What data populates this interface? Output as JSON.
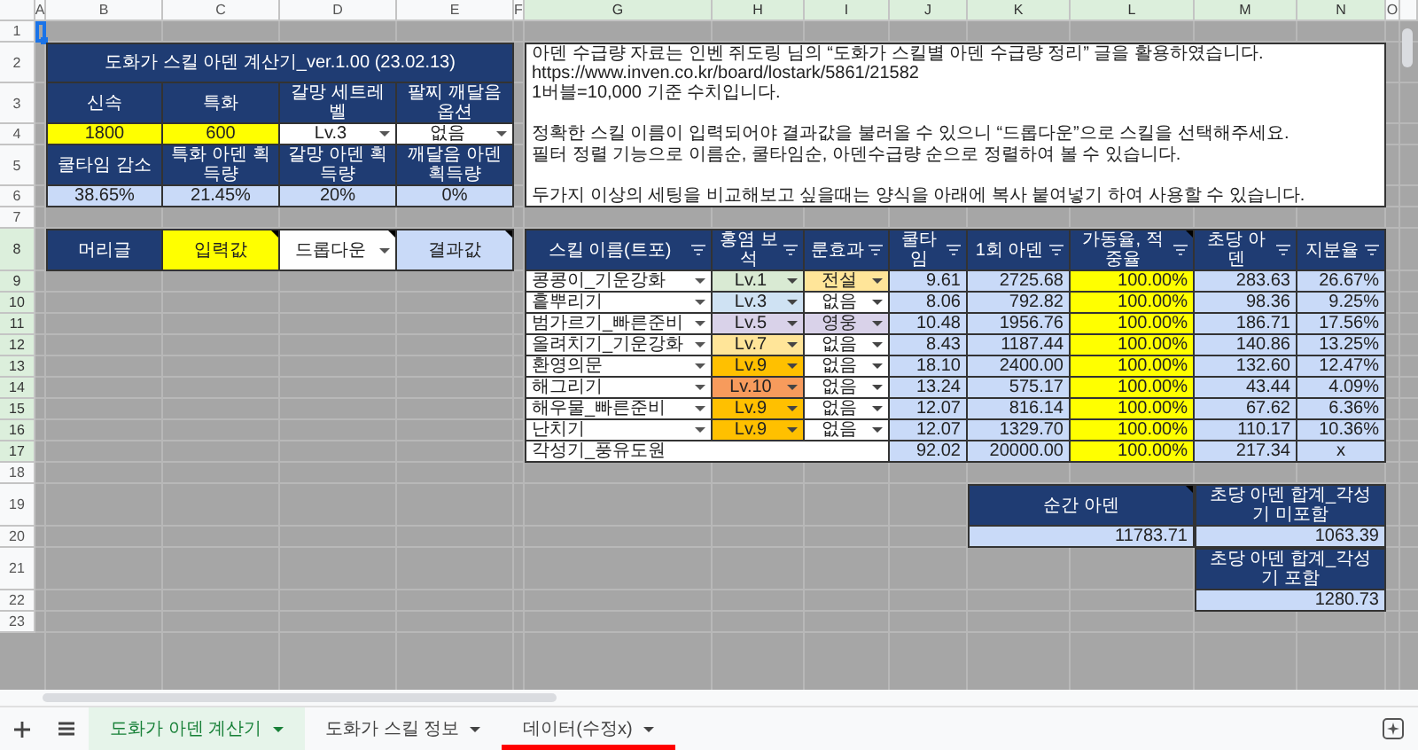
{
  "column_headers": [
    {
      "label": "A",
      "highlighted": false
    },
    {
      "label": "B",
      "highlighted": false
    },
    {
      "label": "C",
      "highlighted": false
    },
    {
      "label": "D",
      "highlighted": false
    },
    {
      "label": "E",
      "highlighted": false
    },
    {
      "label": "F",
      "highlighted": false
    },
    {
      "label": "G",
      "highlighted": true
    },
    {
      "label": "H",
      "highlighted": true
    },
    {
      "label": "I",
      "highlighted": true
    },
    {
      "label": "J",
      "highlighted": true
    },
    {
      "label": "K",
      "highlighted": true
    },
    {
      "label": "L",
      "highlighted": true
    },
    {
      "label": "M",
      "highlighted": true
    },
    {
      "label": "N",
      "highlighted": true
    },
    {
      "label": "O",
      "highlighted": false
    }
  ],
  "row_numbers": [
    {
      "label": "1",
      "highlighted": false
    },
    {
      "label": "2",
      "highlighted": false
    },
    {
      "label": "3",
      "highlighted": false
    },
    {
      "label": "4",
      "highlighted": false
    },
    {
      "label": "5",
      "highlighted": false
    },
    {
      "label": "6",
      "highlighted": false
    },
    {
      "label": "7",
      "highlighted": false
    },
    {
      "label": "8",
      "highlighted": true
    },
    {
      "label": "9",
      "highlighted": true
    },
    {
      "label": "10",
      "highlighted": true
    },
    {
      "label": "11",
      "highlighted": true
    },
    {
      "label": "12",
      "highlighted": true
    },
    {
      "label": "13",
      "highlighted": true
    },
    {
      "label": "14",
      "highlighted": true
    },
    {
      "label": "15",
      "highlighted": true
    },
    {
      "label": "16",
      "highlighted": true
    },
    {
      "label": "17",
      "highlighted": true
    },
    {
      "label": "18",
      "highlighted": false
    },
    {
      "label": "19",
      "highlighted": false
    },
    {
      "label": "20",
      "highlighted": false
    },
    {
      "label": "21",
      "highlighted": false
    },
    {
      "label": "22",
      "highlighted": false
    },
    {
      "label": "23",
      "highlighted": false
    }
  ],
  "calculator": {
    "title": "도화가 스킬 아덴 계산기_ver.1.00 (23.02.13)",
    "stat_headers": [
      "신속",
      "특화",
      "갈망 세트레벨",
      "팔찌 깨달음 옵션"
    ],
    "stat_values": [
      {
        "text": "1800",
        "kind": "input"
      },
      {
        "text": "600",
        "kind": "input"
      },
      {
        "text": "Lv.3",
        "kind": "dropdown"
      },
      {
        "text": "없음",
        "kind": "dropdown"
      }
    ],
    "result_headers": [
      "쿨타임 감소",
      "특화 아덴 획득량",
      "갈망 아덴 획득량",
      "깨달음 아덴 획득량"
    ],
    "result_values": [
      "38.65%",
      "21.45%",
      "20%",
      "0%"
    ]
  },
  "legend": [
    {
      "text": "머리글",
      "kind": "header",
      "note": false
    },
    {
      "text": "입력값",
      "kind": "input",
      "note": true
    },
    {
      "text": "드롭다운",
      "kind": "dropdown",
      "note": true
    },
    {
      "text": "결과값",
      "kind": "result",
      "note": true
    }
  ],
  "notes": [
    {
      "text": "아덴 수급량 자료는 인벤 쥐도링 님의 “도화가 스킬별 아덴 수급량 정리” 글을 활용하였습니다.",
      "link": "https://www.inven.co.kr/board/lostark/5861/21582"
    },
    {
      "text": "1버블=10,000 기준 수치입니다."
    },
    {
      "text": "정확한 스킬 이름이 입력되어야 결과값을 불러올 수 있으니 “드롭다운”으로 스킬을 선택해주세요."
    },
    {
      "text": "필터 정렬 기능으로 이름순, 쿨타임순, 아덴수급량 순으로 정렬하여 볼 수 있습니다."
    },
    {
      "text": "두가지 이상의 세팅을 비교해보고 싶을때는 양식을 아래에 복사 붙여넣기 하여 사용할 수 있습니다."
    }
  ],
  "skill_table": {
    "columns": [
      {
        "label": "스킬 이름(트포)",
        "note": false
      },
      {
        "label": "홍염 보석",
        "note": false
      },
      {
        "label": "룬효과",
        "note": false
      },
      {
        "label": "쿨타임",
        "note": false
      },
      {
        "label": "1회 아덴",
        "note": false
      },
      {
        "label": "가동율, 적중율",
        "note": true
      },
      {
        "label": "초당 아덴",
        "note": false
      },
      {
        "label": "지분율",
        "note": false
      }
    ],
    "rows": [
      {
        "skill": "콩콩이_기운강화",
        "gem": {
          "text": "Lv.1",
          "color": "#d9ead3"
        },
        "rune": {
          "text": "전설",
          "color": "#ffe599"
        },
        "cooldown": "9.61",
        "damage": "2725.68",
        "uptime": "100.00%",
        "per_second": "283.63",
        "share": "26.67%"
      },
      {
        "skill": "흩뿌리기",
        "gem": {
          "text": "Lv.3",
          "color": "#cfe2f3"
        },
        "rune": {
          "text": "없음",
          "color": "#ffffff"
        },
        "cooldown": "8.06",
        "damage": "792.82",
        "uptime": "100.00%",
        "per_second": "98.36",
        "share": "9.25%"
      },
      {
        "skill": "범가르기_빠른준비",
        "gem": {
          "text": "Lv.5",
          "color": "#d9d2e9"
        },
        "rune": {
          "text": "영웅",
          "color": "#d9d2e9"
        },
        "cooldown": "10.48",
        "damage": "1956.76",
        "uptime": "100.00%",
        "per_second": "186.71",
        "share": "17.56%"
      },
      {
        "skill": "올려치기_기운강화",
        "gem": {
          "text": "Lv.7",
          "color": "#ffe599"
        },
        "rune": {
          "text": "없음",
          "color": "#ffffff"
        },
        "cooldown": "8.43",
        "damage": "1187.44",
        "uptime": "100.00%",
        "per_second": "140.86",
        "share": "13.25%"
      },
      {
        "skill": "환영의문",
        "gem": {
          "text": "Lv.9",
          "color": "#ffc000"
        },
        "rune": {
          "text": "없음",
          "color": "#ffffff"
        },
        "cooldown": "18.10",
        "damage": "2400.00",
        "uptime": "100.00%",
        "per_second": "132.60",
        "share": "12.47%"
      },
      {
        "skill": "해그리기",
        "gem": {
          "text": "Lv.10",
          "color": "#f79b5c"
        },
        "rune": {
          "text": "없음",
          "color": "#ffffff"
        },
        "cooldown": "13.24",
        "damage": "575.17",
        "uptime": "100.00%",
        "per_second": "43.44",
        "share": "4.09%"
      },
      {
        "skill": "해우물_빠른준비",
        "gem": {
          "text": "Lv.9",
          "color": "#ffc000"
        },
        "rune": {
          "text": "없음",
          "color": "#ffffff"
        },
        "cooldown": "12.07",
        "damage": "816.14",
        "uptime": "100.00%",
        "per_second": "67.62",
        "share": "6.36%"
      },
      {
        "skill": "난치기",
        "gem": {
          "text": "Lv.9",
          "color": "#ffc000"
        },
        "rune": {
          "text": "없음",
          "color": "#ffffff"
        },
        "cooldown": "12.07",
        "damage": "1329.70",
        "uptime": "100.00%",
        "per_second": "110.17",
        "share": "10.36%"
      }
    ],
    "total": {
      "skill": "각성기_풍유도원",
      "cooldown": "92.02",
      "damage": "20000.00",
      "uptime": "100.00%",
      "per_second": "217.34",
      "share": "x"
    }
  },
  "summary": [
    {
      "label": "순간 아덴",
      "value": "11783.71",
      "note": true
    },
    {
      "label": "초당 아덴 합계_각성기 미포함",
      "value": "1063.39",
      "note": false
    },
    {
      "label": "초당 아덴 합계_각성기 포함",
      "value": "1280.73",
      "note": false
    }
  ],
  "sheet_tabs": [
    {
      "label": "도화가 아덴 계산기",
      "selected": true
    },
    {
      "label": "도화가 스킬 정보",
      "selected": false
    },
    {
      "label": "데이터(수정x)",
      "selected": false,
      "color": "#ff0000"
    }
  ]
}
